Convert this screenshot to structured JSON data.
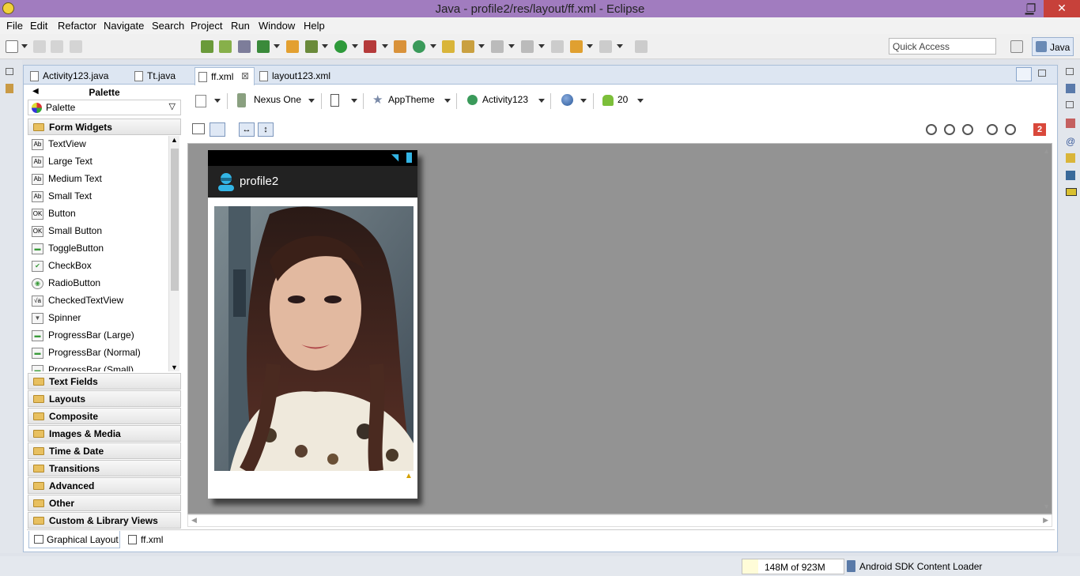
{
  "window": {
    "title": "Java - profile2/res/layout/ff.xml - Eclipse",
    "minimize": "▁",
    "maximize": "❐",
    "close": "✕"
  },
  "menu": [
    "File",
    "Edit",
    "Refactor",
    "Navigate",
    "Search",
    "Project",
    "Run",
    "Window",
    "Help"
  ],
  "toolbar": {
    "quick_access_placeholder": "Quick Access",
    "perspective_label": "Java"
  },
  "editor_tabs": [
    {
      "label": "Activity123.java",
      "active": false
    },
    {
      "label": "Tt.java",
      "active": false
    },
    {
      "label": "ff.xml",
      "active": true,
      "close": "⊠"
    },
    {
      "label": "layout123.xml",
      "active": false
    }
  ],
  "palette": {
    "header": "Palette",
    "selector_label": "Palette",
    "open_category": "Form Widgets",
    "items": [
      {
        "label": "TextView",
        "icon": "Ab"
      },
      {
        "label": "Large Text",
        "icon": "Ab"
      },
      {
        "label": "Medium Text",
        "icon": "Ab"
      },
      {
        "label": "Small Text",
        "icon": "Ab"
      },
      {
        "label": "Button",
        "icon": "OK"
      },
      {
        "label": "Small Button",
        "icon": "OK"
      },
      {
        "label": "ToggleButton",
        "icon": "▬"
      },
      {
        "label": "CheckBox",
        "icon": "✔"
      },
      {
        "label": "RadioButton",
        "icon": "◉"
      },
      {
        "label": "CheckedTextView",
        "icon": "√a"
      },
      {
        "label": "Spinner",
        "icon": "▼"
      },
      {
        "label": "ProgressBar (Large)",
        "icon": "▬"
      },
      {
        "label": "ProgressBar (Normal)",
        "icon": "▬"
      },
      {
        "label": "ProgressBar (Small)",
        "icon": "▬"
      }
    ],
    "categories": [
      "Text Fields",
      "Layouts",
      "Composite",
      "Images & Media",
      "Time & Date",
      "Transitions",
      "Advanced",
      "Other",
      "Custom & Library Views"
    ]
  },
  "layout_toolbar": {
    "device": "Nexus One",
    "theme": "AppTheme",
    "activity": "Activity123",
    "api_level": "20",
    "error_count": "2"
  },
  "device_preview": {
    "app_title": "profile2"
  },
  "bottom_tabs": [
    "Graphical Layout",
    "ff.xml"
  ],
  "status": {
    "memory": "148M of 923M",
    "memory_used_fraction": 0.16,
    "loader": "Android SDK Content Loader"
  },
  "colors": {
    "title_bar": "#a17cbf",
    "close_button": "#c7413a",
    "error_badge": "#d9483b",
    "canvas_bg": "#939393"
  }
}
